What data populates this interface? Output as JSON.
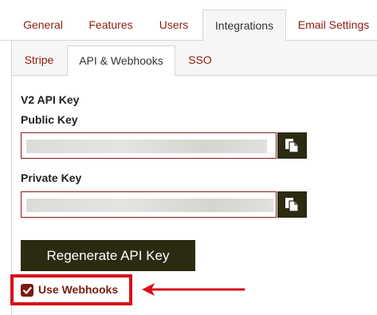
{
  "tabs": [
    {
      "label": "General",
      "active": false
    },
    {
      "label": "Features",
      "active": false
    },
    {
      "label": "Users",
      "active": false
    },
    {
      "label": "Integrations",
      "active": true
    },
    {
      "label": "Email Settings",
      "active": false
    }
  ],
  "subtabs": [
    {
      "label": "Stripe",
      "active": false
    },
    {
      "label": "API & Webhooks",
      "active": true
    },
    {
      "label": "SSO",
      "active": false
    }
  ],
  "section_title": "V2 API Key",
  "public_key": {
    "label": "Public Key",
    "value_state": "masked"
  },
  "private_key": {
    "label": "Private Key",
    "value_state": "masked"
  },
  "regenerate_label": "Regenerate API Key",
  "webhooks": {
    "label": "Use Webhooks",
    "checked": true
  },
  "colors": {
    "accent": "#8a1d11",
    "button": "#2b2b11",
    "annotation": "#d90f18"
  },
  "icons": {
    "copy": "copy-icon",
    "check": "check-icon"
  }
}
